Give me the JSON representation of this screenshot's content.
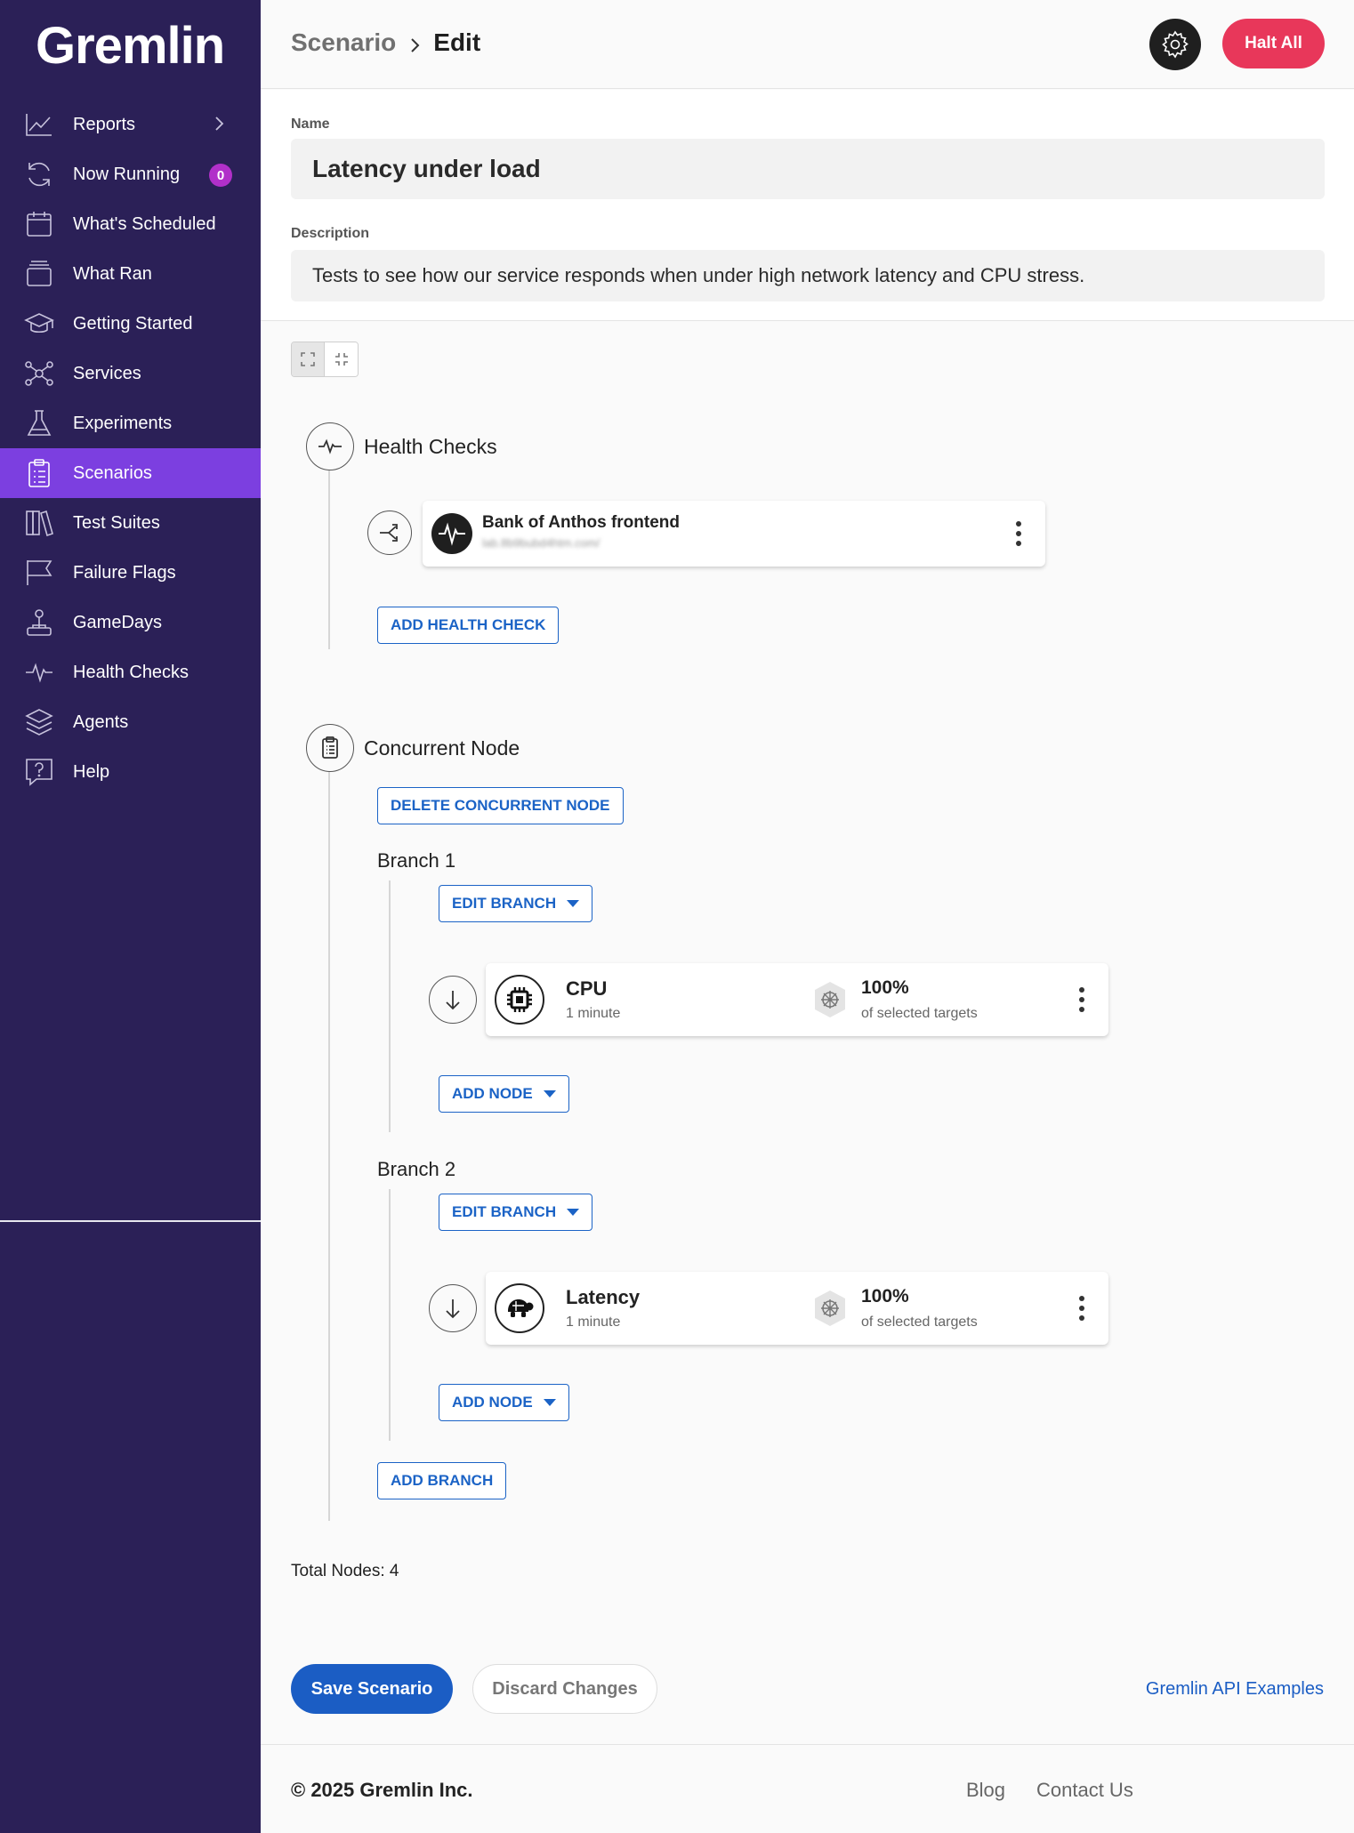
{
  "app": {
    "logo": "Gremlin"
  },
  "sidebar": {
    "items": [
      {
        "label": "Reports",
        "icon": "chart-icon",
        "has_chevron": true
      },
      {
        "label": "Now Running",
        "icon": "refresh-icon",
        "badge": "0"
      },
      {
        "label": "What's Scheduled",
        "icon": "calendar-icon"
      },
      {
        "label": "What Ran",
        "icon": "stack-icon"
      },
      {
        "label": "Getting Started",
        "icon": "graduation-cap-icon"
      },
      {
        "label": "Services",
        "icon": "network-icon"
      },
      {
        "label": "Experiments",
        "icon": "flask-icon"
      },
      {
        "label": "Scenarios",
        "icon": "clipboard-icon",
        "active": true
      },
      {
        "label": "Test Suites",
        "icon": "books-icon"
      },
      {
        "label": "Failure Flags",
        "icon": "flag-icon"
      },
      {
        "label": "GameDays",
        "icon": "joystick-icon"
      },
      {
        "label": "Health Checks",
        "icon": "pulse-icon"
      },
      {
        "label": "Agents",
        "icon": "layers-icon"
      },
      {
        "label": "Help",
        "icon": "help-icon"
      }
    ]
  },
  "header": {
    "breadcrumb_parent": "Scenario",
    "breadcrumb_current": "Edit",
    "halt_label": "Halt All"
  },
  "form": {
    "name_label": "Name",
    "name_value": "Latency under load",
    "description_label": "Description",
    "description_value": "Tests to see how our service responds when under high network latency and CPU stress."
  },
  "health_checks": {
    "title": "Health Checks",
    "card": {
      "title": "Bank of Anthos frontend",
      "url": "lab.8b9bubd4htm.com/"
    },
    "add_label": "ADD HEALTH CHECK"
  },
  "concurrent": {
    "title": "Concurrent Node",
    "delete_label": "DELETE CONCURRENT NODE",
    "add_branch_label": "ADD BRANCH",
    "branches": [
      {
        "label": "Branch 1",
        "edit_label": "EDIT BRANCH",
        "add_node_label": "ADD NODE",
        "node": {
          "name": "CPU",
          "duration": "1 minute",
          "percent": "100%",
          "targets": "of selected targets"
        }
      },
      {
        "label": "Branch 2",
        "edit_label": "EDIT BRANCH",
        "add_node_label": "ADD NODE",
        "node": {
          "name": "Latency",
          "duration": "1 minute",
          "percent": "100%",
          "targets": "of selected targets"
        }
      }
    ]
  },
  "summary": {
    "total_nodes": "Total Nodes: 4"
  },
  "actions": {
    "save_label": "Save Scenario",
    "discard_label": "Discard Changes",
    "api_link": "Gremlin API Examples"
  },
  "footer": {
    "copyright": "© 2025 Gremlin Inc.",
    "blog": "Blog",
    "contact": "Contact Us"
  },
  "colors": {
    "sidebar_bg": "#2b2057",
    "sidebar_active": "#7c3fe0",
    "badge": "#b130c9",
    "halt": "#e8375a",
    "primary": "#1b5dc4",
    "link": "#1b63c6"
  }
}
